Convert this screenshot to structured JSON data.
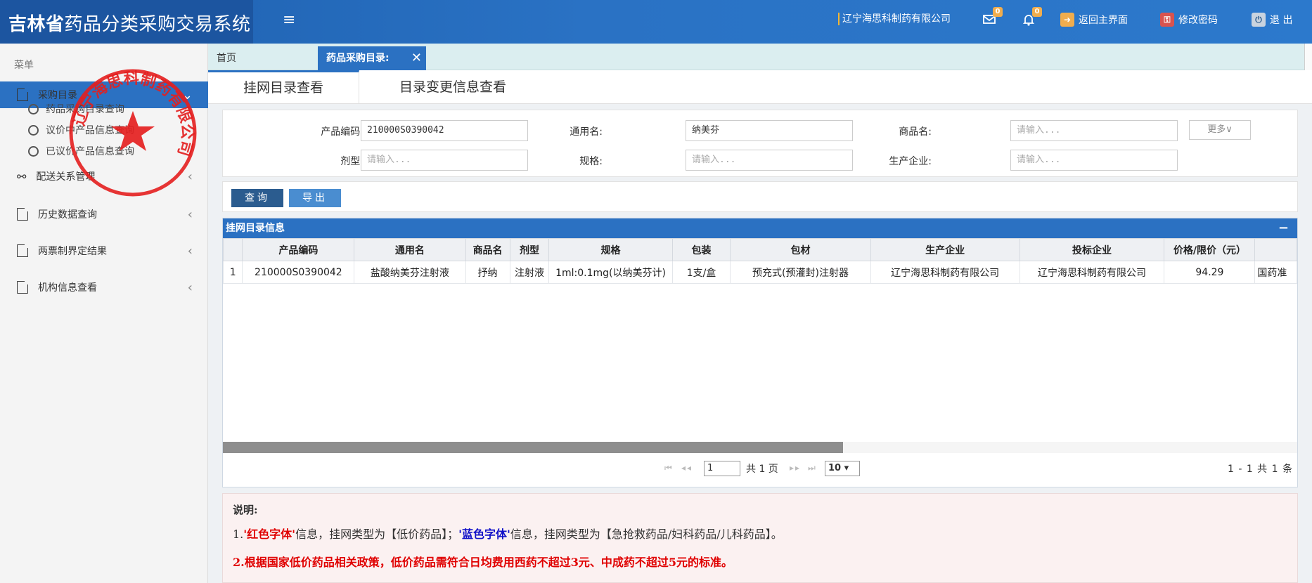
{
  "header": {
    "title_bold": "吉林省",
    "title_rest": "药品分类采购交易系统",
    "company": "辽宁海思科制药有限公司",
    "mail_count": "0",
    "bell_count": "0",
    "back_label": "返回主界面",
    "password_label": "修改密码",
    "logout_label": "退 出"
  },
  "sidebar": {
    "caption": "菜单",
    "items": [
      {
        "label": "采购目录"
      },
      {
        "label": "配送关系管理"
      },
      {
        "label": "历史数据查询"
      },
      {
        "label": "两票制界定结果"
      },
      {
        "label": "机构信息查看"
      }
    ],
    "sub_items": [
      {
        "label": "药品采购目录查询"
      },
      {
        "label": "议价中产品信息查询"
      },
      {
        "label": "已议价产品信息查询"
      }
    ],
    "stamp_text": "辽宁海思科制药有限公司"
  },
  "tabs": {
    "home": "首页",
    "active": "药品采购目录:"
  },
  "subtabs": [
    "挂网目录查看",
    "目录变更信息查看"
  ],
  "search": {
    "code_label": "产品编码:",
    "code_value": "210000S0390042",
    "generic_label": "通用名:",
    "generic_value": "纳美芬",
    "trade_label": "商品名:",
    "trade_placeholder": "请输入...",
    "form_label": "剂型:",
    "form_placeholder": "请输入...",
    "spec_label": "规格:",
    "spec_placeholder": "请输入...",
    "maker_label": "生产企业:",
    "maker_placeholder": "请输入...",
    "more_label": "更多∨"
  },
  "buttons": {
    "query": "查询",
    "export": "导出"
  },
  "grid": {
    "title": "挂网目录信息",
    "columns": [
      "",
      "产品编码",
      "通用名",
      "商品名",
      "剂型",
      "规格",
      "包装",
      "包材",
      "生产企业",
      "投标企业",
      "价格/限价（元）",
      ""
    ],
    "rows": [
      [
        "1",
        "210000S0390042",
        "盐酸纳美芬注射液",
        "抒纳",
        "注射液",
        "1ml:0.1mg(以纳美芬计)",
        "1支/盒",
        "预充式(预灌封)注射器",
        "辽宁海思科制药有限公司",
        "辽宁海思科制药有限公司",
        "94.29",
        "国药准"
      ]
    ],
    "pager": {
      "page": "1",
      "total_pages": "共 1 页",
      "page_size": "10 ▾",
      "range": "1 - 1  共 1 条"
    }
  },
  "notes": {
    "title": "说明:",
    "l1_prefix": "1.",
    "l1_red": "'红色字体'",
    "l1_mid": "信息，挂网类型为【低价药品】；",
    "l1_blue": "'蓝色字体'",
    "l1_end": "信息，挂网类型为【急抢救药品/妇科药品/儿科药品】。",
    "l2_prefix": "2.",
    "l2_red": "根据国家低价药品相关政策，低价药品需符合日均费用西药不超过3元、中成药不超过5元的标准。"
  }
}
